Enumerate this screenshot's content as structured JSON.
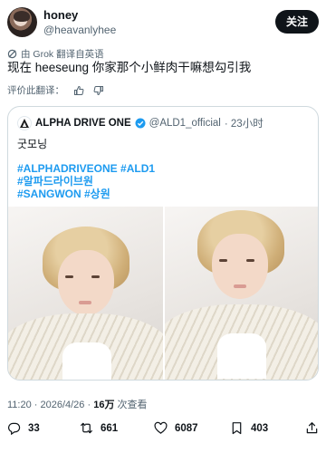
{
  "user": {
    "display_name": "honey",
    "handle": "@heavanlyhee",
    "follow_label": "关注"
  },
  "translation": {
    "note": "由 Grok 翻译自英语",
    "rate_label": "评价此翻译："
  },
  "post": {
    "text": "现在 heeseung 你家那个小鲜肉干嘛想勾引我"
  },
  "quote": {
    "name": "ALPHA DRIVE ONE",
    "handle": "@ALD1_official",
    "time": "· 23小时",
    "text": "굿모닝",
    "hashtags": [
      "#ALPHADRIVEONE #ALD1",
      "#알파드라이브원",
      "#SANGWON #상원"
    ]
  },
  "meta": {
    "time_date": "11:20 · 2026/4/26 · ",
    "views": "16万",
    "views_label": " 次查看"
  },
  "actions": {
    "replies": "33",
    "reposts": "661",
    "likes": "6087",
    "bookmarks": "403"
  },
  "colors": {
    "accent": "#1d9bf0",
    "text": "#0f1419",
    "muted": "#536471"
  }
}
